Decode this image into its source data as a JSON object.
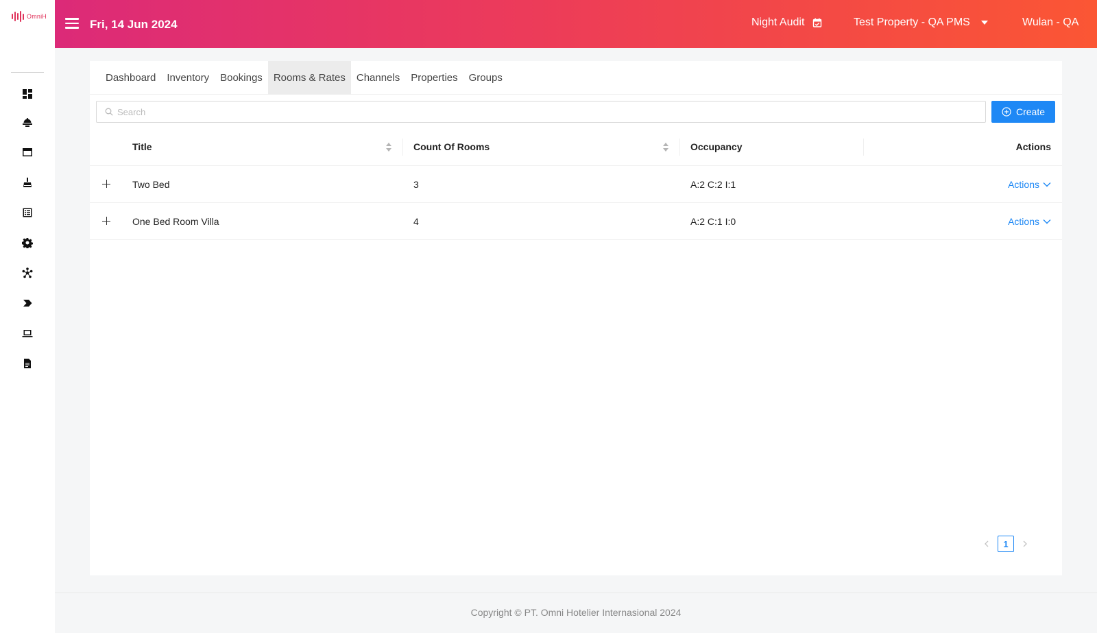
{
  "brand": {
    "logo_text": "OmniH"
  },
  "sidebar": {
    "items": [
      {
        "icon": "dashboard-icon"
      },
      {
        "icon": "concierge-bell-icon"
      },
      {
        "icon": "window-icon"
      },
      {
        "icon": "housekeeping-broom-icon"
      },
      {
        "icon": "list-icon"
      },
      {
        "icon": "gear-icon"
      },
      {
        "icon": "network-icon"
      },
      {
        "icon": "tag-icon"
      },
      {
        "icon": "laptop-icon"
      },
      {
        "icon": "report-file-icon"
      }
    ]
  },
  "header": {
    "date": "Fri, 14 Jun 2024",
    "night_audit": "Night Audit",
    "property": "Test Property - QA PMS",
    "user": "Wulan - QA"
  },
  "tabs": [
    "Dashboard",
    "Inventory",
    "Bookings",
    "Rooms & Rates",
    "Channels",
    "Properties",
    "Groups"
  ],
  "active_tab": "Rooms & Rates",
  "search": {
    "placeholder": "Search",
    "value": ""
  },
  "create_label": "Create",
  "table": {
    "columns": [
      "Title",
      "Count Of Rooms",
      "Occupancy",
      "Actions"
    ],
    "rows": [
      {
        "title": "Two Bed",
        "count": "3",
        "occupancy": "A:2 C:2 I:1",
        "action": "Actions"
      },
      {
        "title": "One Bed Room Villa",
        "count": "4",
        "occupancy": "A:2 C:1 I:0",
        "action": "Actions"
      }
    ]
  },
  "pagination": {
    "current": "1"
  },
  "footer": "Copyright © PT. Omni Hotelier Internasional 2024",
  "colors": {
    "primary": "#1e88f5",
    "header_start": "#dc2a78",
    "header_end": "#fb5634",
    "brand": "#e0325a"
  }
}
